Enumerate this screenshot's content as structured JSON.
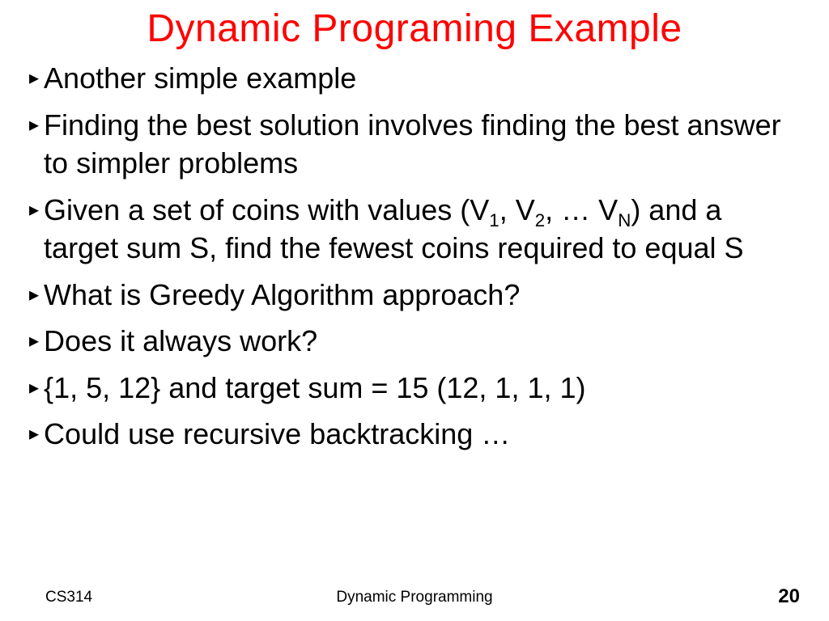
{
  "title": "Dynamic Programing Example",
  "bullets": [
    {
      "text": "Another simple example"
    },
    {
      "text": "Finding the best solution involves finding the best answer to simpler problems"
    },
    {
      "html": "Given a set of coins with values (V<sub>1</sub>, V<sub>2</sub>, &hellip; V<sub>N</sub>) and a target sum S, find the fewest coins required to equal S"
    },
    {
      "text": "What is Greedy Algorithm approach?"
    },
    {
      "text": "Does it always work?"
    },
    {
      "text": "{1, 5, 12} and target sum = 15 (12, 1, 1, 1)"
    },
    {
      "text": "Could use recursive backtracking …"
    }
  ],
  "footer": {
    "left": "CS314",
    "center": "Dynamic Programming",
    "right": "20"
  }
}
